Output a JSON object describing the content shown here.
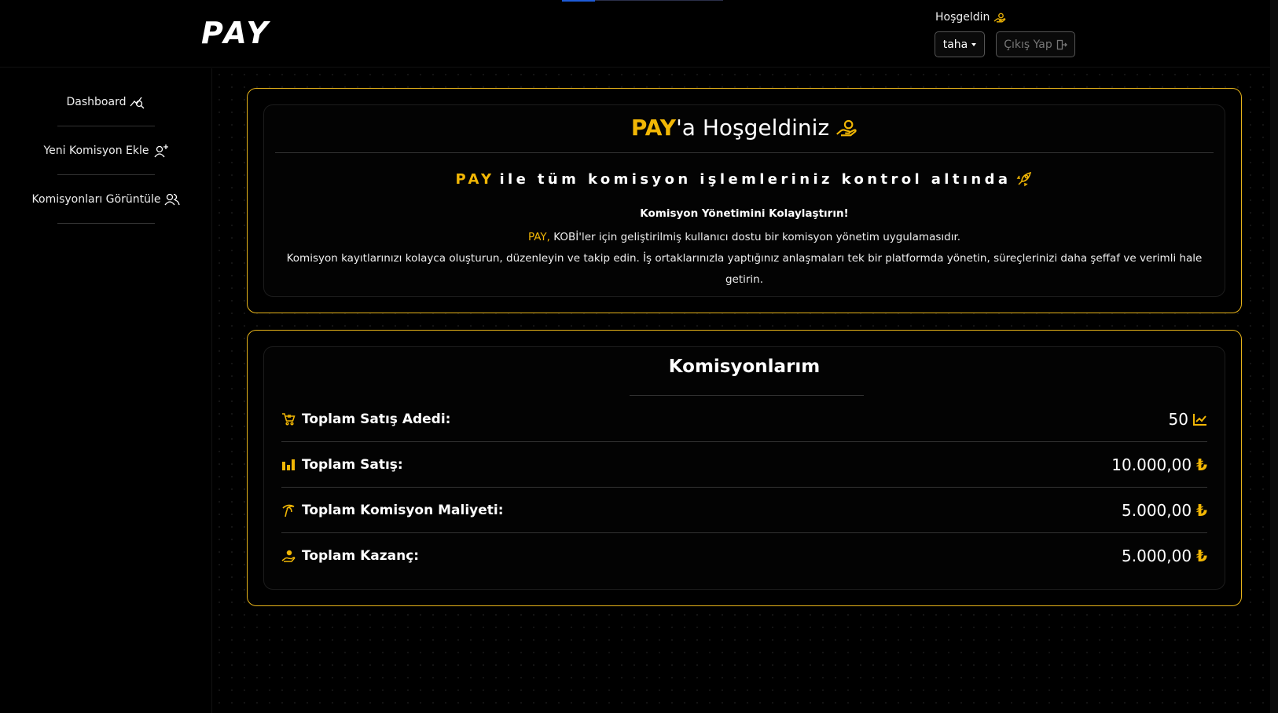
{
  "header": {
    "logo": "PAY",
    "welcome": "Hoşgeldin",
    "user": "taha",
    "logout_label": "Çıkış Yap"
  },
  "sidebar": {
    "items": [
      {
        "label": "Dashboard",
        "icon": "chart-search-icon"
      },
      {
        "label": "Yeni Komisyon Ekle",
        "icon": "user-plus-icon"
      },
      {
        "label": "Komisyonları Görüntüle",
        "icon": "users-icon"
      }
    ]
  },
  "hero": {
    "brand": "PAY",
    "title_rest": "'a Hoşgeldiniz",
    "tagline_brand": "PAY",
    "tagline_rest": "ile tüm komisyon işlemleriniz kontrol altında",
    "subtitle": "Komisyon Yönetimini Kolaylaştırın!",
    "desc_brand": "PAY,",
    "desc_line1": " KOBİ'ler için geliştirilmiş kullanıcı dostu bir komisyon yönetim uygulamasıdır.",
    "desc_line2": "Komisyon kayıtlarınızı kolayca oluşturun, düzenleyin ve takip edin. İş ortaklarınızla yaptığınız anlaşmaları tek bir platformda yönetin, süreçlerinizi daha şeffaf ve verimli hale getirin."
  },
  "stats": {
    "title": "Komisyonlarım",
    "rows": [
      {
        "label": "Toplam Satış Adedi:",
        "value": "50",
        "icon": "cart-icon",
        "suffix_icon": "trend-up-icon"
      },
      {
        "label": "Toplam Satış:",
        "value": "10.000,00",
        "icon": "bar-chart-icon",
        "suffix": "₺"
      },
      {
        "label": "Toplam Komisyon Maliyeti:",
        "value": "5.000,00",
        "icon": "palm-tree-icon",
        "suffix": "₺"
      },
      {
        "label": "Toplam Kazanç:",
        "value": "5.000,00",
        "icon": "hand-coins-icon",
        "suffix": "₺"
      }
    ]
  },
  "colors": {
    "accent": "#f2b705",
    "card_border": "#e8b41a",
    "background": "#000000"
  }
}
